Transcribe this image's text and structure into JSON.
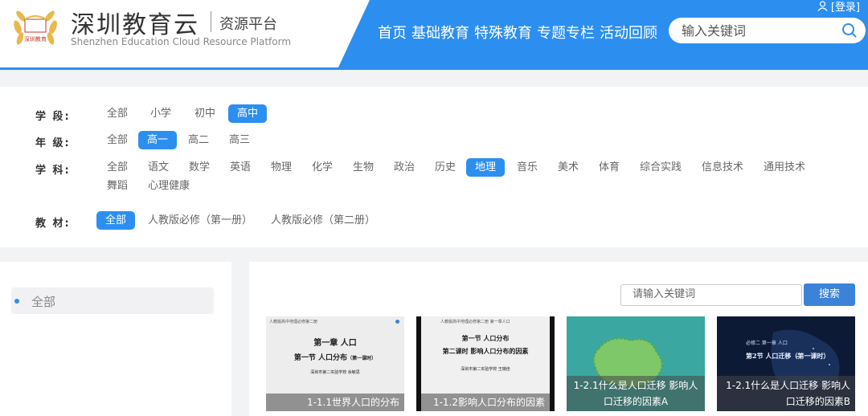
{
  "header": {
    "brand_cn": "深圳教育云",
    "brand_sub": "资源平台",
    "brand_en": "Shenzhen Education Cloud Resource Platform",
    "logo_text": "深圳教育",
    "login": "[登录]",
    "nav": [
      "首页",
      "基础教育",
      "特殊教育",
      "专题专栏",
      "活动回顾"
    ],
    "search_placeholder": "输入关键词"
  },
  "filters": {
    "stage": {
      "label": "学 段:",
      "options": [
        "全部",
        "小学",
        "初中",
        "高中"
      ],
      "selected": "高中"
    },
    "grade": {
      "label": "年 级:",
      "options": [
        "全部",
        "高一",
        "高二",
        "高三"
      ],
      "selected": "高一"
    },
    "subject": {
      "label": "学 科:",
      "options": [
        "全部",
        "语文",
        "数学",
        "英语",
        "物理",
        "化学",
        "生物",
        "政治",
        "历史",
        "地理",
        "音乐",
        "美术",
        "体育",
        "综合实践",
        "信息技术",
        "通用技术",
        "舞蹈",
        "心理健康"
      ],
      "selected": "地理"
    },
    "textbook": {
      "label": "教 材:",
      "options": [
        "全部",
        "人教版必修（第一册）",
        "人教版必修（第二册）"
      ],
      "selected": "全部"
    }
  },
  "sidebar": {
    "items": [
      {
        "label": "全部"
      }
    ]
  },
  "main": {
    "search_placeholder": "请输入关键词",
    "search_button": "搜索",
    "cards": [
      {
        "caption": "1-1.1世界人口的分布",
        "header": "人教版高中地理必修第二册",
        "line1": "第一章 人口",
        "line2": "第一节 人口分布",
        "line2b": "（第一课时）",
        "school": "深圳市第二实验学校 余敏思"
      },
      {
        "caption": "1-1.2影响人口分布的因素",
        "header": "人教版高中地理必修第二册 第一章人口",
        "line1": "第一节 人口分布",
        "line2": "第二课时 影响人口分布的因素",
        "school": "深圳市第二实验学校 王璐佳"
      },
      {
        "caption": "1-2.1什么是人口迁移 影响人口迁移的因素A"
      },
      {
        "caption": "1-2.1什么是人口迁移 影响人口迁移的因素B",
        "line1": "必修二 第一章 人口",
        "line2": "第2节 人口迁移（第一课时）"
      }
    ]
  },
  "colors": {
    "accent": "#2c8ff0",
    "button": "#3b82d9"
  }
}
